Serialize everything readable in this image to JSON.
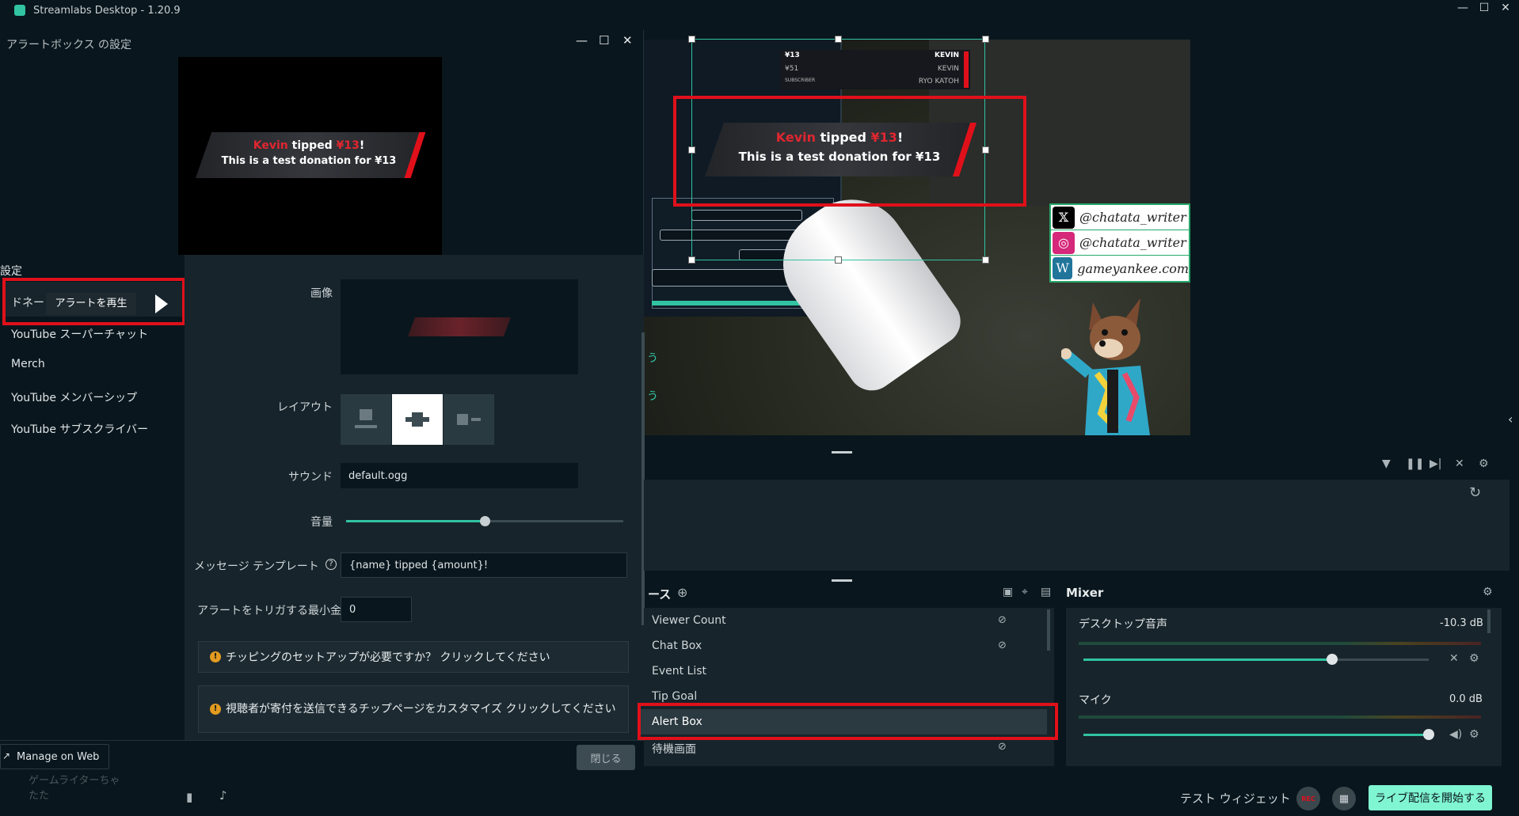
{
  "window": {
    "title": "Streamlabs Desktop - 1.20.9",
    "min": "—",
    "max": "☐",
    "close": "✕"
  },
  "preview": {
    "top_banner": {
      "rows": [
        {
          "left": "¥13",
          "right": "KEVIN"
        },
        {
          "left": "¥51",
          "right": "KEVIN"
        },
        {
          "left": "SUBSCRIBER",
          "right": "RYO KATOH"
        }
      ]
    },
    "alert": {
      "name": "Kevin",
      "tipped": " tipped ",
      "amount": "¥13",
      "excl": "!",
      "message": "This is a test donation for ¥13"
    },
    "social": [
      {
        "icon": "x-icon",
        "glyph": "𝕏",
        "color": "#000000",
        "handle": "@chatata_writer"
      },
      {
        "icon": "instagram-icon",
        "glyph": "◎",
        "color": "#d6287a",
        "handle": "@chatata_writer"
      },
      {
        "icon": "wordpress-icon",
        "glyph": "W",
        "color": "#21759b",
        "handle": "gameyankee.com"
      }
    ],
    "side_text": [
      "う",
      "う"
    ]
  },
  "dialog": {
    "title": "アラートボックス の設定",
    "min": "—",
    "max": "☐",
    "close": "✕",
    "settings_label": "設定",
    "nav": {
      "active_label": "ドネー",
      "tooltip": "アラートを再生",
      "items": [
        "YouTube スーパーチャット",
        "Merch",
        "YouTube メンバーシップ",
        "YouTube サブスクライバー"
      ]
    },
    "form": {
      "image_label": "画像",
      "layout_label": "レイアウト",
      "sound_label": "サウンド",
      "sound_value": "default.ogg",
      "volume_label": "音量",
      "volume_value": 0.5,
      "template_label": "メッセージ テンプレート",
      "template_help": "?",
      "template_value": "{name} tipped {amount}!",
      "min_amount_label": "アラートをトリガする最小金",
      "min_amount_value": "0",
      "info1": "チッピングのセットアップが必要ですか？ クリックしてください",
      "info2": "視聴者が寄付を送信できるチップページをカスタマイズ クリックしてください",
      "info_icon": "!"
    },
    "manage_web": "Manage on Web",
    "close_button": "閉じる"
  },
  "sidebar_bottom": {
    "text1": "ゲームライターちゃ",
    "text2": "たた"
  },
  "events": {
    "refresh_icon": "↻"
  },
  "sources": {
    "title": "ース",
    "items": [
      "Viewer Count",
      "Chat Box",
      "Event List",
      "Tip Goal",
      "Alert Box",
      "待機画面"
    ],
    "selected_index": 4
  },
  "mixer": {
    "title": "Mixer",
    "channels": [
      {
        "name": "デスクトップ音声",
        "db": "-10.3 dB",
        "level": 0.72
      },
      {
        "name": "マイク",
        "db": "0.0 dB",
        "level": 1.0
      }
    ]
  },
  "bottom": {
    "test_widget": "テスト ウィジェット",
    "rec": "REC",
    "go_live": "ライブ配信を開始する"
  },
  "colors": {
    "accent": "#31c3a2",
    "annotation_red": "#e0101a",
    "go_live": "#80f5d2"
  }
}
